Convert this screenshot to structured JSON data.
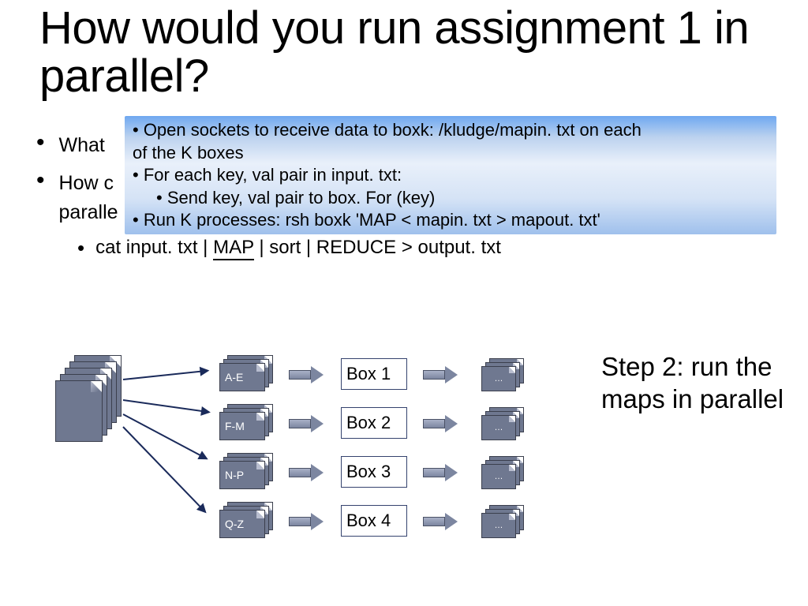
{
  "title": "How would you run assignment 1 in parallel?",
  "bullets": {
    "b1": "What",
    "b2a": "How c",
    "b2b": "paralle"
  },
  "overlay": {
    "l1": "• Open sockets to receive data to boxk: /kludge/mapin. txt on each",
    "l2": "of the K boxes",
    "l3": "• For each key, val pair in input. txt:",
    "l4": "• Send key, val pair to box. For (key)",
    "l5": "• Run K processes: rsh boxk 'MAP < mapin. txt > mapout. txt'"
  },
  "pipeline": {
    "pre": "cat input. txt | ",
    "map": "MAP",
    "post": " | sort | REDUCE > output. txt"
  },
  "ranges": [
    "A-E",
    "F-M",
    "N-P",
    "Q-Z"
  ],
  "boxes": [
    "Box 1",
    "Box 2",
    "Box 3",
    "Box 4"
  ],
  "ellipsis": "…",
  "step_label": "Step 2: run the maps in parallel"
}
